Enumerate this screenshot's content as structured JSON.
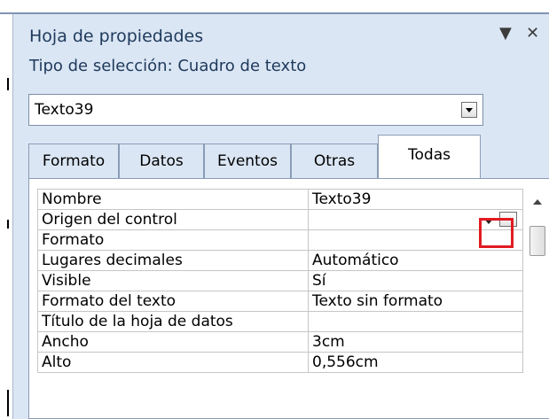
{
  "pane": {
    "title": "Hoja de propiedades",
    "menu_glyph": "▼",
    "close_glyph": "✕",
    "selection_type": "Tipo de selección:  Cuadro de texto"
  },
  "object_selector": {
    "value": "Texto39"
  },
  "tabs": [
    {
      "label": "Formato"
    },
    {
      "label": "Datos"
    },
    {
      "label": "Eventos"
    },
    {
      "label": "Otras"
    },
    {
      "label": "Todas",
      "active": true
    }
  ],
  "properties": [
    {
      "name": "Nombre",
      "value": "Texto39"
    },
    {
      "name": "Origen del control",
      "value": ""
    },
    {
      "name": "Formato",
      "value": ""
    },
    {
      "name": "Lugares decimales",
      "value": "Automático"
    },
    {
      "name": "Visible",
      "value": "Sí"
    },
    {
      "name": "Formato del texto",
      "value": "Texto sin formato"
    },
    {
      "name": "Título de la hoja de datos",
      "value": ""
    },
    {
      "name": "Ancho",
      "value": "3cm"
    },
    {
      "name": "Alto",
      "value": "0,556cm"
    }
  ],
  "builder_button": {
    "label": "..."
  },
  "colors": {
    "pane_bg": "#dbe6f4",
    "title_text": "#1e395b",
    "highlight": "#e11b22"
  }
}
